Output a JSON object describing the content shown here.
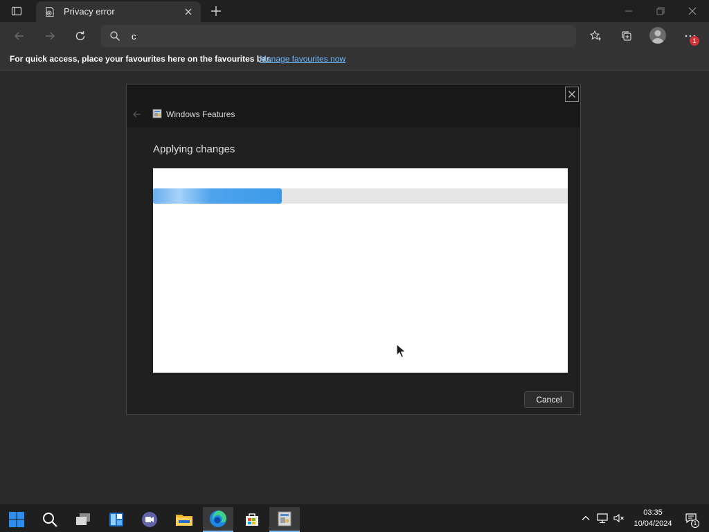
{
  "browser": {
    "tab": {
      "title": "Privacy error"
    },
    "address_bar": {
      "value": "c"
    },
    "notification_badge": "1",
    "favourites_bar": {
      "message": "For quick access, place your favourites here on the favourites bar.",
      "link": "Manage favourites now"
    }
  },
  "dialog": {
    "title": "Windows Features",
    "heading": "Applying changes",
    "progress": 0.31,
    "cancel_label": "Cancel"
  },
  "taskbar": {
    "time": "03:35",
    "date": "10/04/2024",
    "notification_count": "1"
  },
  "colors": {
    "accent": "#3b9ae8",
    "link": "#6cb4f8",
    "badge": "#d13438"
  },
  "icons": {
    "tabbar": [
      "tab-actions-icon",
      "privacy-error-icon",
      "close-icon",
      "plus-icon",
      "minimize-icon",
      "restore-icon",
      "close-icon"
    ],
    "toolbar": [
      "back-arrow-icon",
      "forward-arrow-icon",
      "refresh-icon",
      "search-icon",
      "favorites-star-icon",
      "collections-icon",
      "profile-icon",
      "more-icon"
    ],
    "taskbar": [
      "windows-start-icon",
      "search-icon",
      "task-view-icon",
      "widgets-icon",
      "teams-chat-icon",
      "file-explorer-icon",
      "edge-icon",
      "store-icon",
      "windows-features-icon"
    ],
    "tray": [
      "chevron-up-icon",
      "network-icon",
      "volume-muted-icon",
      "notifications-icon"
    ]
  }
}
